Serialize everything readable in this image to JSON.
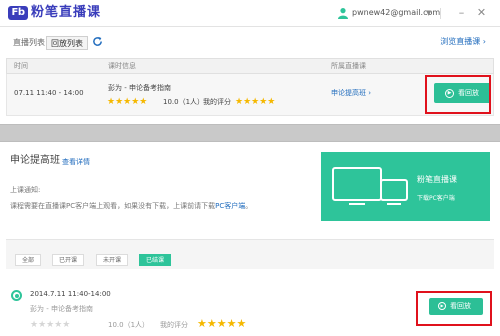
{
  "app": {
    "logo_text": "Fb",
    "name": "粉笔直播课"
  },
  "user": {
    "email": "pwnew42@gmail.com"
  },
  "window_controls": {
    "minimize": "–",
    "close": "✕"
  },
  "tabs": [
    {
      "label": "直播列表"
    },
    {
      "label": "回放列表"
    }
  ],
  "browse_link": "浏览直播课 ›",
  "table": {
    "headers": [
      "时间",
      "课时信息",
      "所属直播课"
    ],
    "row": {
      "time": "07.11 11:40 - 14:00",
      "lesson": "彭为 - 申论备考指南",
      "rating_stars": 5,
      "score_text": "10.0（1人）",
      "my_rating_label": "我的评分",
      "my_rating_stars": 5,
      "class_link": "申论提高班 ›",
      "replay_button": "看回放"
    }
  },
  "course": {
    "title": "申论提高班",
    "detail_link": "查看详情",
    "notice_title": "上课通知:",
    "notice_text_before": "课程需要在直播课PC客户端上观看，如果没有下载，上课前请下载",
    "notice_link": "PC客户端",
    "notice_text_after": "。",
    "banner_title": "粉笔直播课",
    "banner_subtitle": "下载PC客户端",
    "filters": [
      "全部",
      "已开课",
      "未开课",
      "已结课"
    ],
    "active_filter": "已结课",
    "lesson": {
      "time": "2014.7.11 11:40-14:00",
      "title": "彭为 - 申论备考指南",
      "rating_stars": 0,
      "score_text": "10.0（1人）",
      "my_rating_label": "我的评分",
      "my_rating_stars": 5,
      "replay_button": "看回放"
    }
  },
  "colors": {
    "accent": "#2ec49a",
    "brand": "#3a3dbb",
    "link": "#1f6bbd",
    "star": "#f5b800",
    "highlight": "#e0111c"
  }
}
